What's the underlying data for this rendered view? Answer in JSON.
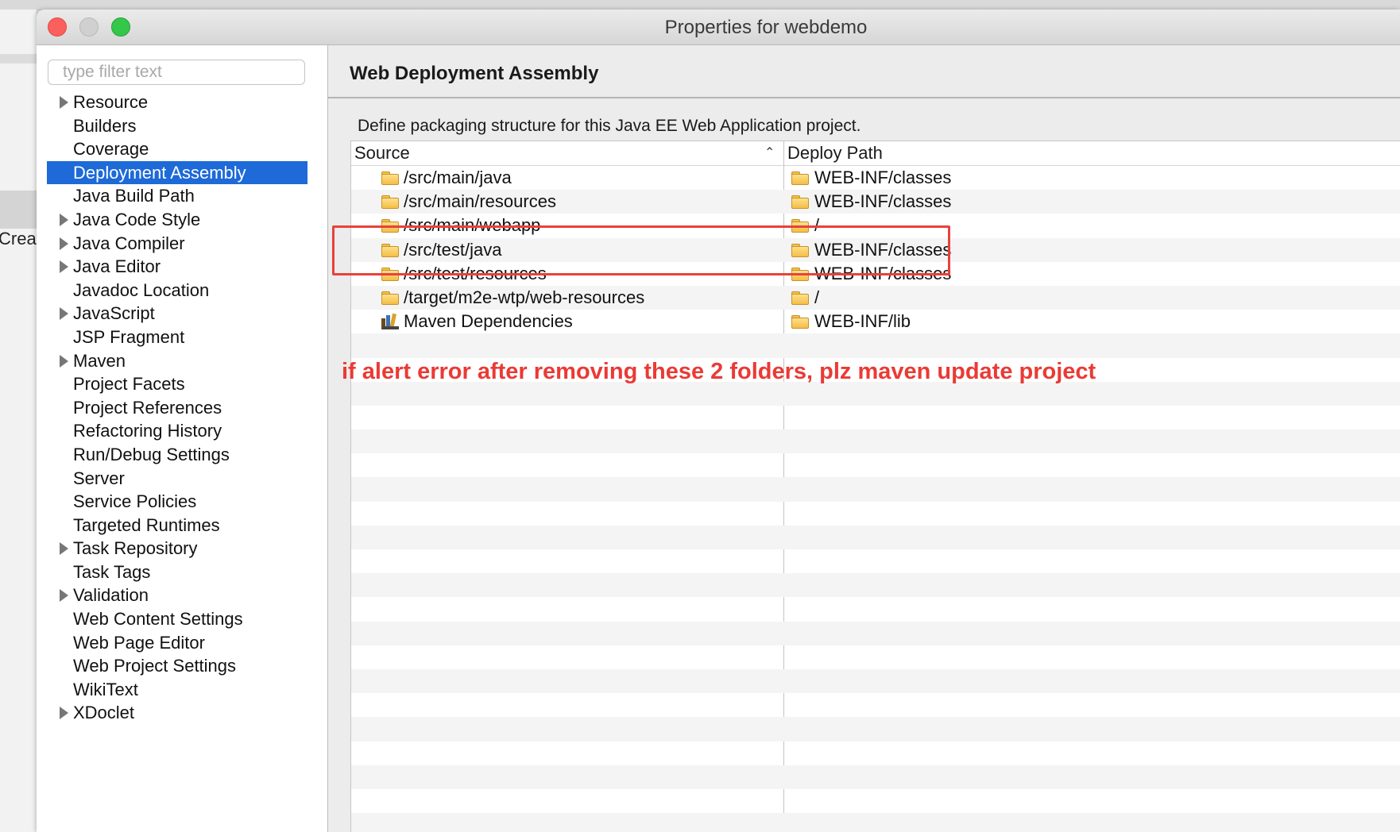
{
  "background": {
    "partial_text": "Creat"
  },
  "window": {
    "title": "Properties for webdemo"
  },
  "sidebar": {
    "filter_placeholder": "type filter text",
    "items": [
      {
        "label": "Resource",
        "expandable": true,
        "selected": false
      },
      {
        "label": "Builders",
        "expandable": false,
        "selected": false
      },
      {
        "label": "Coverage",
        "expandable": false,
        "selected": false
      },
      {
        "label": "Deployment Assembly",
        "expandable": false,
        "selected": true
      },
      {
        "label": "Java Build Path",
        "expandable": false,
        "selected": false
      },
      {
        "label": "Java Code Style",
        "expandable": true,
        "selected": false
      },
      {
        "label": "Java Compiler",
        "expandable": true,
        "selected": false
      },
      {
        "label": "Java Editor",
        "expandable": true,
        "selected": false
      },
      {
        "label": "Javadoc Location",
        "expandable": false,
        "selected": false
      },
      {
        "label": "JavaScript",
        "expandable": true,
        "selected": false
      },
      {
        "label": "JSP Fragment",
        "expandable": false,
        "selected": false
      },
      {
        "label": "Maven",
        "expandable": true,
        "selected": false
      },
      {
        "label": "Project Facets",
        "expandable": false,
        "selected": false
      },
      {
        "label": "Project References",
        "expandable": false,
        "selected": false
      },
      {
        "label": "Refactoring History",
        "expandable": false,
        "selected": false
      },
      {
        "label": "Run/Debug Settings",
        "expandable": false,
        "selected": false
      },
      {
        "label": "Server",
        "expandable": false,
        "selected": false
      },
      {
        "label": "Service Policies",
        "expandable": false,
        "selected": false
      },
      {
        "label": "Targeted Runtimes",
        "expandable": false,
        "selected": false
      },
      {
        "label": "Task Repository",
        "expandable": true,
        "selected": false
      },
      {
        "label": "Task Tags",
        "expandable": false,
        "selected": false
      },
      {
        "label": "Validation",
        "expandable": true,
        "selected": false
      },
      {
        "label": "Web Content Settings",
        "expandable": false,
        "selected": false
      },
      {
        "label": "Web Page Editor",
        "expandable": false,
        "selected": false
      },
      {
        "label": "Web Project Settings",
        "expandable": false,
        "selected": false
      },
      {
        "label": "WikiText",
        "expandable": false,
        "selected": false
      },
      {
        "label": "XDoclet",
        "expandable": true,
        "selected": false
      }
    ]
  },
  "main": {
    "title": "Web Deployment Assembly",
    "description": "Define packaging structure for this Java EE Web Application project.",
    "table": {
      "columns": [
        "Source",
        "Deploy Path"
      ],
      "sort_icon": "chevron-up-icon",
      "rows": [
        {
          "source": "/src/main/java",
          "source_icon": "folder-icon",
          "deploy": "WEB-INF/classes"
        },
        {
          "source": "/src/main/resources",
          "source_icon": "folder-icon",
          "deploy": "WEB-INF/classes"
        },
        {
          "source": "/src/main/webapp",
          "source_icon": "folder-icon",
          "deploy": "/"
        },
        {
          "source": "/src/test/java",
          "source_icon": "folder-icon",
          "deploy": "WEB-INF/classes"
        },
        {
          "source": "/src/test/resources",
          "source_icon": "folder-icon",
          "deploy": "WEB-INF/classes"
        },
        {
          "source": "/target/m2e-wtp/web-resources",
          "source_icon": "folder-icon",
          "deploy": "/"
        },
        {
          "source": "Maven Dependencies",
          "source_icon": "library-icon",
          "deploy": "WEB-INF/lib"
        }
      ]
    }
  },
  "annotation": {
    "text": "if alert error after removing these 2 folders, plz maven update project",
    "color": "#ea3a35"
  },
  "colors": {
    "selection": "#1d6ad8",
    "close": "#fc605c",
    "maximize": "#34c84a"
  }
}
